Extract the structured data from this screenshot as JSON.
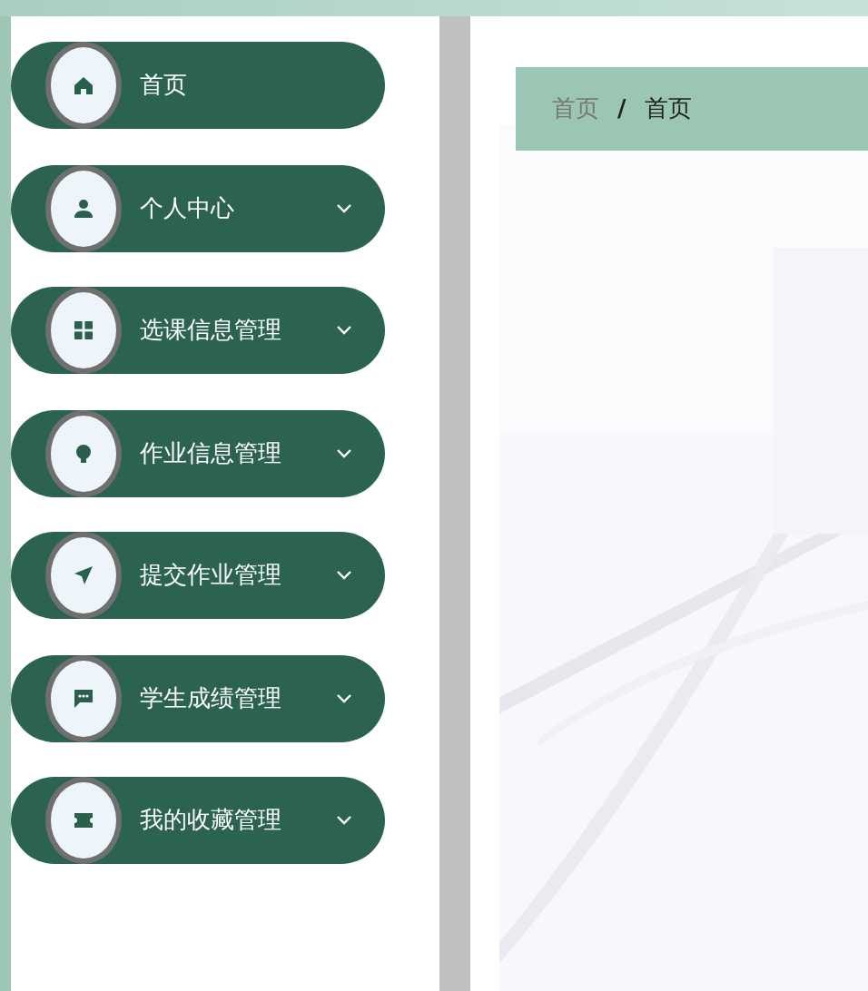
{
  "sidebar": {
    "items": [
      {
        "label": "首页",
        "kind": "link"
      },
      {
        "label": "个人中心",
        "kind": "submenu"
      },
      {
        "label": "选课信息管理",
        "kind": "submenu"
      },
      {
        "label": "作业信息管理",
        "kind": "submenu"
      },
      {
        "label": "提交作业管理",
        "kind": "submenu"
      },
      {
        "label": "学生成绩管理",
        "kind": "submenu"
      },
      {
        "label": "我的收藏管理",
        "kind": "submenu"
      }
    ]
  },
  "breadcrumb": [
    {
      "label": "首页",
      "current": false
    },
    {
      "label": "/",
      "kind": "separator"
    },
    {
      "label": "首页",
      "current": true
    }
  ]
}
